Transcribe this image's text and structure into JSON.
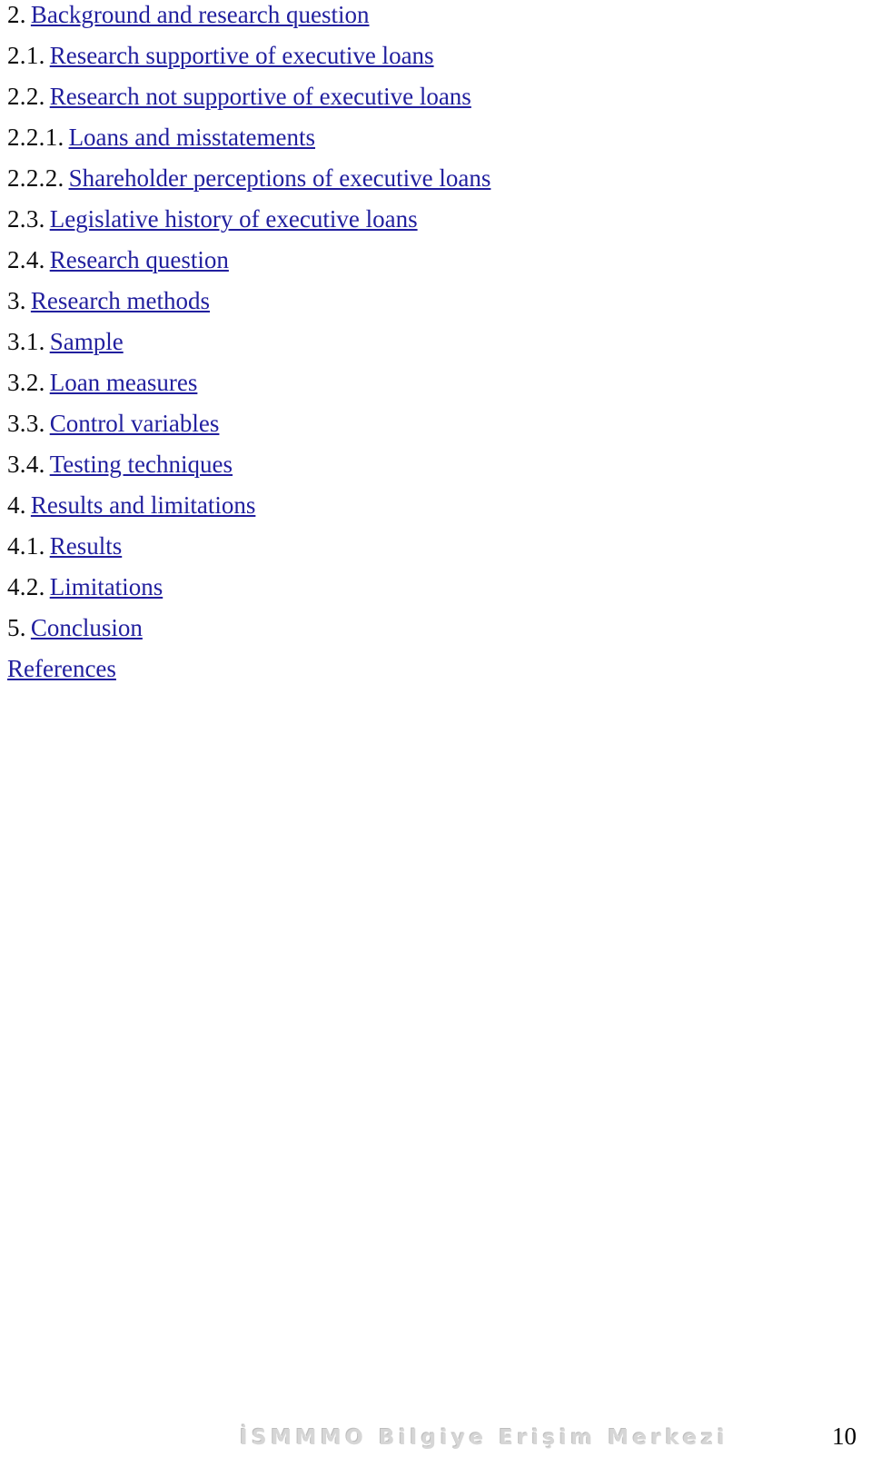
{
  "document": {
    "type": "table-of-contents",
    "page_number": "10",
    "link_color": "#211f9e",
    "text_color": "#000000",
    "watermark_color": "#d6d6d6"
  },
  "toc": {
    "entries": [
      {
        "number": "2.",
        "title": "Background and research question"
      },
      {
        "number": "2.1.",
        "title": "Research supportive of executive loans"
      },
      {
        "number": "2.2.",
        "title": "Research not supportive of executive loans"
      },
      {
        "number": "2.2.1.",
        "title": "Loans and misstatements"
      },
      {
        "number": "2.2.2.",
        "title": "Shareholder perceptions of executive loans"
      },
      {
        "number": "2.3.",
        "title": "Legislative history of executive loans"
      },
      {
        "number": "2.4.",
        "title": "Research question"
      },
      {
        "number": "3.",
        "title": "Research methods"
      },
      {
        "number": "3.1.",
        "title": "Sample"
      },
      {
        "number": "3.2.",
        "title": "Loan measures"
      },
      {
        "number": "3.3.",
        "title": "Control variables"
      },
      {
        "number": "3.4.",
        "title": "Testing techniques"
      },
      {
        "number": "4.",
        "title": "Results and limitations"
      },
      {
        "number": "4.1.",
        "title": "Results"
      },
      {
        "number": "4.2.",
        "title": "Limitations"
      },
      {
        "number": "5.",
        "title": "Conclusion"
      },
      {
        "number": "",
        "title": "References"
      }
    ]
  },
  "footer": {
    "watermark": "İSMMMO Bilgiye Erişim Merkezi",
    "page_number": "10"
  }
}
